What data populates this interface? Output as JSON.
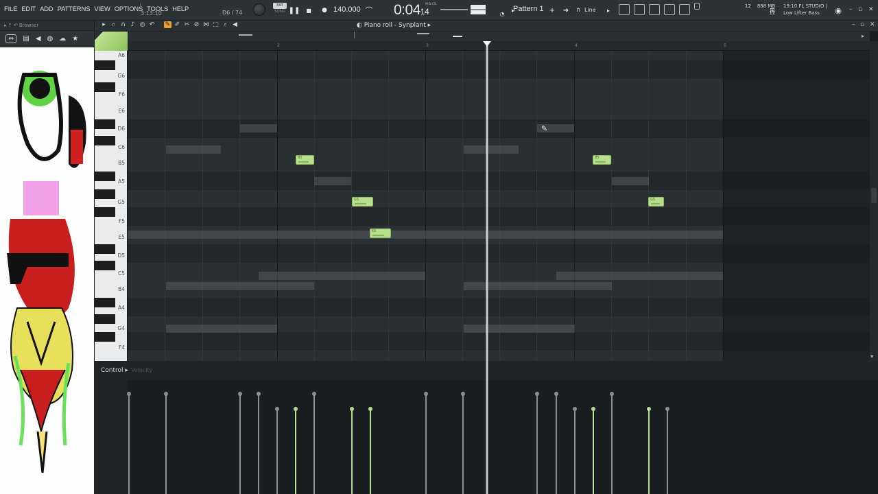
{
  "menu": [
    "FILE",
    "EDIT",
    "ADD",
    "PATTERNS",
    "VIEW",
    "OPTIONS",
    "TOOLS",
    "HELP"
  ],
  "hint": "3:13:10",
  "note_info": "D6 / 74",
  "pat_label": "PAT",
  "song_label": "SONG",
  "tempo": "140.000",
  "time": {
    "main": "0:04",
    "frac": "14",
    "unit": "M:S:CS"
  },
  "pattern": "Pattern 1",
  "snap": "Line",
  "memory": {
    "cpu": "12",
    "ram": "888 MB",
    "voices": "12"
  },
  "project": {
    "time": "19:10",
    "app": "FL STUDIO |",
    "preset": "Low Lifter Bass"
  },
  "browser": {
    "title": "Browser"
  },
  "piano_roll": {
    "title": "Piano roll - Synplant"
  },
  "timeline": {
    "bars": [
      "2",
      "3",
      "4",
      "5"
    ]
  },
  "keys": {
    "labels": [
      "A6",
      "G6",
      "F6",
      "E6",
      "D6",
      "C6",
      "B5",
      "A5",
      "G5",
      "F5",
      "E5",
      "D5",
      "C5",
      "B4",
      "A4",
      "G4",
      "F4"
    ]
  },
  "notes": [
    {
      "label": "B5",
      "pitch": "B5"
    },
    {
      "label": "G5",
      "pitch": "G5"
    },
    {
      "label": "E5",
      "pitch": "E5"
    },
    {
      "label": "B5",
      "pitch": "B5"
    },
    {
      "label": "G5",
      "pitch": "G5"
    }
  ],
  "event_editor": {
    "control": "Control",
    "target": "Velocity"
  },
  "colors": {
    "note": "#b7e08c",
    "accent": "#f0a030",
    "background": "#2a2f32"
  }
}
